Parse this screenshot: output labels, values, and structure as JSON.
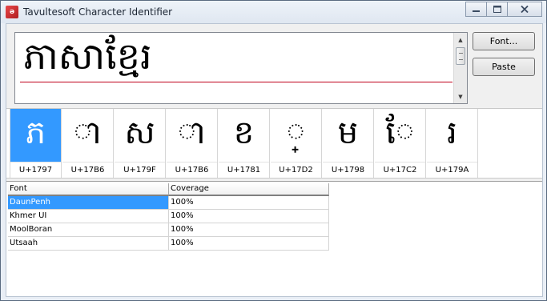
{
  "window": {
    "title": "Tavultesoft Character Identifier",
    "controls": [
      "minimize",
      "maximize",
      "close"
    ]
  },
  "input_text": "ភាសាខ្មែរ",
  "buttons": {
    "font_label": "Font...",
    "paste_label": "Paste"
  },
  "characters": [
    {
      "glyph": "ភ",
      "code": "U+1797",
      "selected": true
    },
    {
      "glyph": "◌ា",
      "code": "U+17B6",
      "selected": false
    },
    {
      "glyph": "ស",
      "code": "U+179F",
      "selected": false
    },
    {
      "glyph": "◌ា",
      "code": "U+17B6",
      "selected": false
    },
    {
      "glyph": "ខ",
      "code": "U+1781",
      "selected": false
    },
    {
      "glyph": "◌្",
      "code": "U+17D2",
      "selected": false
    },
    {
      "glyph": "ម",
      "code": "U+1798",
      "selected": false
    },
    {
      "glyph": "◌ែ",
      "code": "U+17C2",
      "selected": false
    },
    {
      "glyph": "រ",
      "code": "U+179A",
      "selected": false
    }
  ],
  "font_table": {
    "columns": [
      "Font",
      "Coverage"
    ],
    "rows": [
      {
        "font": "DaunPenh",
        "coverage": "100%",
        "selected": true
      },
      {
        "font": "Khmer UI",
        "coverage": "100%",
        "selected": false
      },
      {
        "font": "MoolBoran",
        "coverage": "100%",
        "selected": false
      },
      {
        "font": "Utsaah",
        "coverage": "100%",
        "selected": false
      }
    ]
  },
  "colors": {
    "selection": "#3399ff",
    "underline": "#c0001a"
  }
}
